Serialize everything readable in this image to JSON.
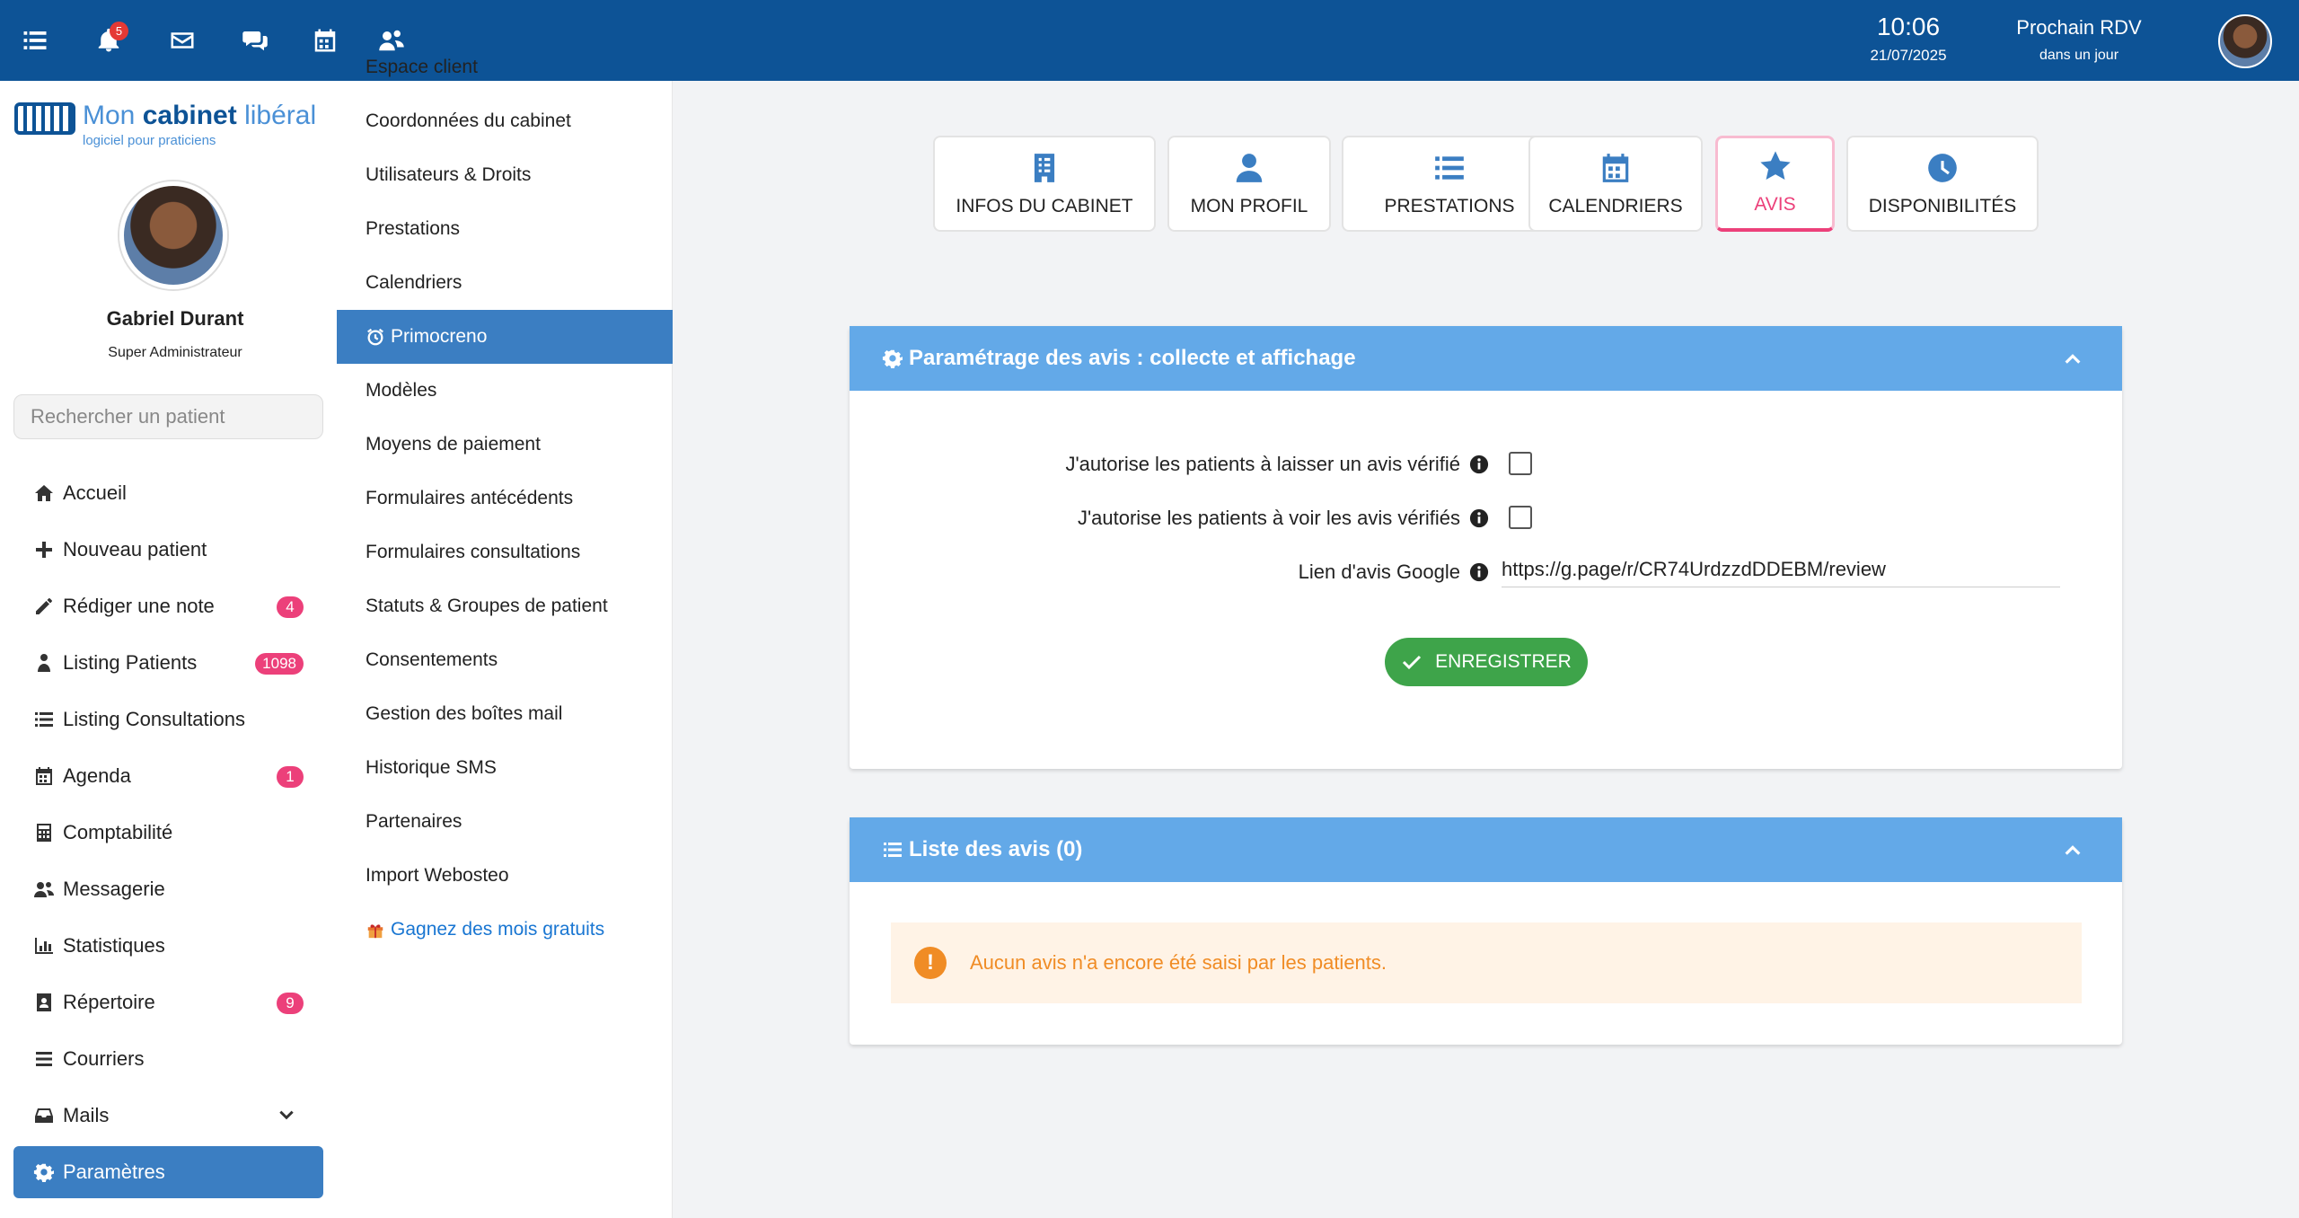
{
  "topbar": {
    "notifications_count": "5",
    "time": "10:06",
    "date": "21/07/2025",
    "next_rdv_title": "Prochain RDV",
    "next_rdv_sub": "dans un jour"
  },
  "sidebar": {
    "logo_brand_part1": "Mon ",
    "logo_brand_part2": "cabinet",
    "logo_brand_part3": " libéral",
    "logo_tagline": "logiciel pour praticiens",
    "user_name": "Gabriel Durant",
    "user_role": "Super Administrateur",
    "search_placeholder": "Rechercher un patient",
    "items": [
      {
        "label": "Accueil",
        "badge": null
      },
      {
        "label": "Nouveau patient",
        "badge": null
      },
      {
        "label": "Rédiger une note",
        "badge": "4"
      },
      {
        "label": "Listing Patients",
        "badge": "1098"
      },
      {
        "label": "Listing Consultations",
        "badge": null
      },
      {
        "label": "Agenda",
        "badge": "1"
      },
      {
        "label": "Comptabilité",
        "badge": null
      },
      {
        "label": "Messagerie",
        "badge": null
      },
      {
        "label": "Statistiques",
        "badge": null
      },
      {
        "label": "Répertoire",
        "badge": "9"
      },
      {
        "label": "Courriers",
        "badge": null
      },
      {
        "label": "Mails",
        "badge": null
      },
      {
        "label": "Paramètres",
        "badge": null
      }
    ]
  },
  "submenu": {
    "items": [
      "Espace client",
      "Coordonnées du cabinet",
      "Utilisateurs & Droits",
      "Prestations",
      "Calendriers",
      "Primocreno",
      "Modèles",
      "Moyens de paiement",
      "Formulaires antécédents",
      "Formulaires consultations",
      "Statuts & Groupes de patient",
      "Consentements",
      "Gestion des boîtes mail",
      "Historique SMS",
      "Partenaires",
      "Import Webosteo",
      "Gagnez des mois gratuits"
    ]
  },
  "tabs": [
    {
      "label": "INFOS DU CABINET",
      "icon": "building-icon"
    },
    {
      "label": "MON PROFIL",
      "icon": "user-icon"
    },
    {
      "label": "PRESTATIONS",
      "icon": "list-icon"
    },
    {
      "label": "CALENDRIERS",
      "icon": "calendar-icon"
    },
    {
      "label": "AVIS",
      "icon": "star-icon"
    },
    {
      "label": "DISPONIBILITÉS",
      "icon": "clock-icon"
    }
  ],
  "settings_card": {
    "title": "Paramétrage des avis : collecte et affichage",
    "field1_label": "J'autorise les patients à laisser un avis vérifié",
    "field2_label": "J'autorise les patients à voir les avis vérifiés",
    "field3_label": "Lien d'avis Google",
    "google_link_value": "https://g.page/r/CR74UrdzzdDDEBM/review",
    "save_label": "ENREGISTRER"
  },
  "list_card": {
    "title": "Liste des avis (0)",
    "empty_message": "Aucun avis n'a encore été saisi par les patients."
  },
  "colors": {
    "topbar": "#0d5396",
    "accent": "#3b7ec2",
    "card_header": "#63a9e8",
    "active_tab": "#ec407a",
    "save": "#3ea44a",
    "warning": "#f08c25"
  }
}
